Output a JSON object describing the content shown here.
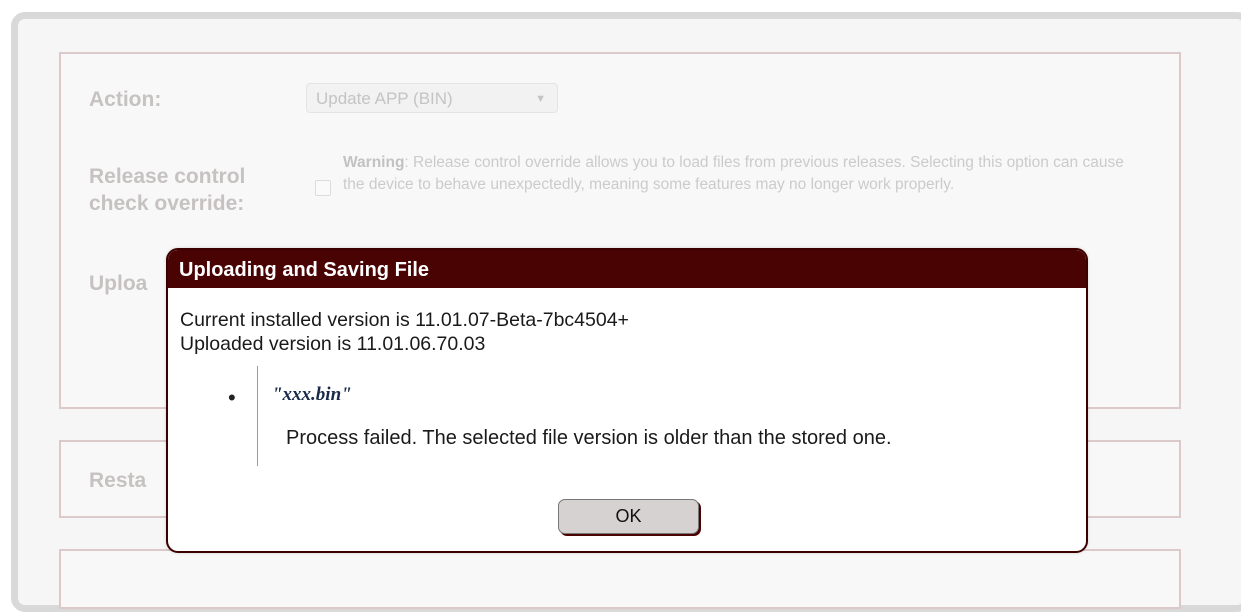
{
  "form": {
    "action_label": "Action:",
    "action_select_value": "Update APP (BIN)",
    "release_label": "Release control check override:",
    "warning_bold": "Warning",
    "warning_text": ": Release control override allows you to load files from previous releases. Selecting this option can cause the device to behave unexpectedly, meaning some features may no longer work properly.",
    "upload_label": "Uploa",
    "restart_label": "Resta"
  },
  "dialog": {
    "title": "Uploading and Saving File",
    "current_version": "Current installed version is 11.01.07-Beta-7bc4504+",
    "uploaded_version": "Uploaded version is 11.01.06.70.03",
    "bullet": "•",
    "file_name": "\"xxx.bin\"",
    "fail_message": "Process failed. The selected file version is older than the stored one.",
    "ok_label": "OK"
  },
  "colors": {
    "dialog_header_bg": "#4a0303",
    "ok_button_bg": "#d7d2d2"
  }
}
